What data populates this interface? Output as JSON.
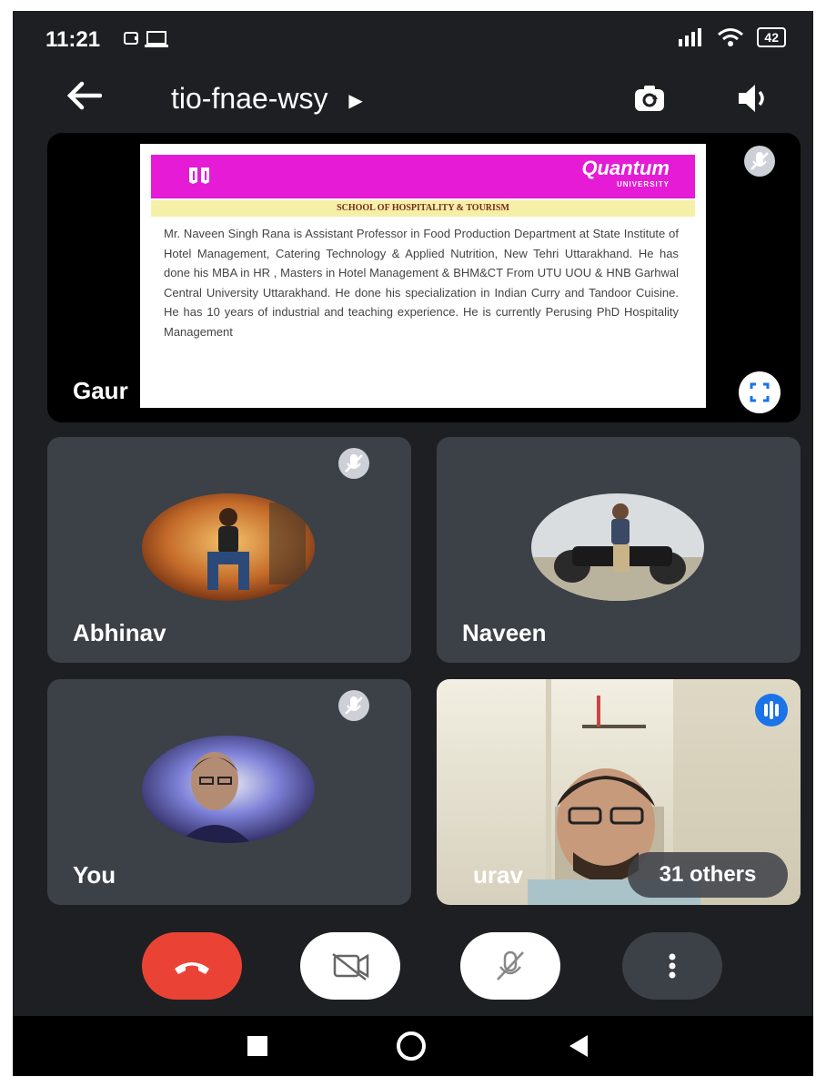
{
  "status_bar": {
    "time": "11:21",
    "battery": "42"
  },
  "meeting": {
    "code": "tio-fnae-wsy"
  },
  "presentation": {
    "presenter_name": "Gaur",
    "slide": {
      "logo_text": "Quantum",
      "logo_subtext": "UNIVERSITY",
      "school": "SCHOOL OF HOSPITALITY & TOURISM",
      "body": "Mr. Naveen Singh Rana is Assistant Professor in Food Production Department at State Institute of Hotel Management, Catering Technology & Applied Nutrition, New Tehri Uttarakhand. He has done his MBA in HR , Masters in Hotel Management & BHM&CT From UTU UOU & HNB Garhwal Central University Uttarakhand. He done his specialization in Indian Curry and Tandoor Cuisine. He has 10 years of industrial and teaching experience. He is currently Perusing PhD Hospitality Management"
    }
  },
  "participants": [
    {
      "name": "Abhinav",
      "muted": true
    },
    {
      "name": "Naveen",
      "muted": false
    },
    {
      "name": "You",
      "muted": true
    },
    {
      "name": "urav",
      "speaking": true
    }
  ],
  "others_label": "31 others",
  "colors": {
    "background": "#1e1f22",
    "tile": "#3c4047",
    "end_call": "#ea4335",
    "accent": "#1a73e8"
  },
  "icons": {
    "back": "arrow-left-icon",
    "switch_camera": "switch-camera-icon",
    "speaker": "speaker-icon",
    "mic_off": "mic-off-icon",
    "fullscreen": "fullscreen-icon",
    "speaking": "audio-level-icon",
    "end_call": "end-call-icon",
    "camera_off": "camera-off-icon",
    "more": "more-vert-icon"
  }
}
